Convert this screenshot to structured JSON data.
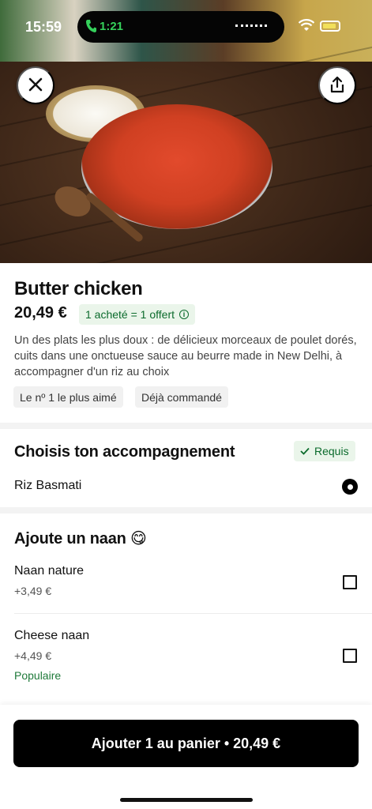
{
  "status_bar": {
    "time": "15:59",
    "call_time": "1:21"
  },
  "header": {
    "close_icon": "close-icon",
    "share_icon": "share-icon"
  },
  "product": {
    "title": "Butter chicken",
    "price": "20,49 €",
    "promo": "1 acheté = 1 offert",
    "description": "Un des plats les plus doux : de délicieux morceaux de poulet dorés, cuits dans une onctueuse sauce au beurre made in New Delhi, à accompagner d'un riz au choix",
    "chips": [
      "Le nº 1 le plus aimé",
      "Déjà commandé"
    ]
  },
  "accompaniment": {
    "title": "Choisis ton accompagnement",
    "required_label": "Requis",
    "options": [
      {
        "label": "Riz Basmati",
        "selected": true
      }
    ]
  },
  "naan": {
    "title": "Ajoute un naan 😋",
    "options": [
      {
        "label": "Naan nature",
        "price": "+3,49 €",
        "checked": false
      },
      {
        "label": "Cheese naan",
        "price": "+4,49 €",
        "badge": "Populaire",
        "checked": false
      }
    ]
  },
  "cta": {
    "label": "Ajouter 1 au panier • 20,49 €"
  },
  "colors": {
    "accent_green": "#0b6b2c",
    "promo_bg": "#eaf5ea",
    "cta_bg": "#000000"
  }
}
